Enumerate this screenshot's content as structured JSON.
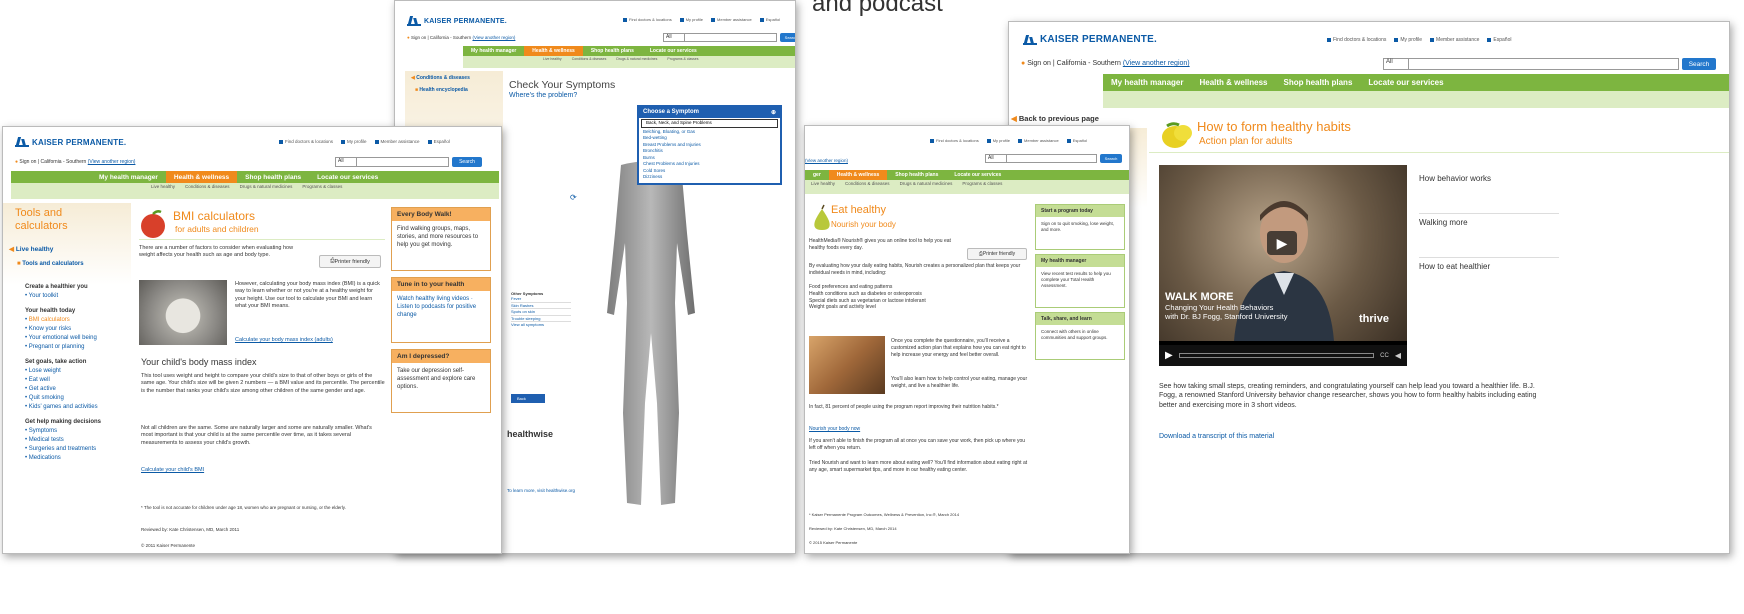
{
  "caption": {
    "text": "and podcast"
  },
  "common": {
    "brand": "KAISER PERMANENTE.",
    "utility_links": [
      "Find doctors & locations",
      "My profile",
      "Member assistance"
    ],
    "espanol": "Español",
    "sign_on": "Sign on",
    "region": "California - Southern",
    "view_region": "(View another region)",
    "search_select": "All",
    "search_btn": "Search",
    "nav": [
      "My health manager",
      "Health & wellness",
      "Shop health plans",
      "Locate our services"
    ],
    "subnav": [
      "Live healthy",
      "Conditions & diseases",
      "Drugs & natural medicines",
      "Programs & classes"
    ]
  },
  "page_bmi": {
    "side_title": "Tools and calculators",
    "side_back": "Live healthy",
    "side_current": "Tools and calculators",
    "side_groups": [
      {
        "h": "Create a healthier you",
        "items": [
          "Your toolkit"
        ]
      },
      {
        "h": "Your health today",
        "items": [
          "BMI calculators",
          "Know your risks",
          "Your emotional well being",
          "Pregnant or planning"
        ]
      },
      {
        "h": "Set goals, take action",
        "items": [
          "Lose weight",
          "Eat well",
          "Get active",
          "Quit smoking",
          "Kids' games and activities"
        ]
      },
      {
        "h": "Get help making decisions",
        "items": [
          "Symptoms",
          "Medical tests",
          "Surgeries and treatments",
          "Medications"
        ]
      }
    ],
    "title": "BMI calculators",
    "subtitle": "for adults and children",
    "intro": "There are a number of factors to consider when evaluating how weight affects your health such as age and body type.",
    "printer": "Printer friendly",
    "para1": "However, calculating your body mass index (BMI) is a quick way to learn whether or not you're at a healthy weight for your height. Use our tool to calculate your BMI and learn what your BMI means.",
    "link1": "Calculate your body mass index (adults)",
    "h2": "Your child's body mass index",
    "para2": "This tool uses weight and height to compare your child's size to that of other boys or girls of the same age. Your child's size will be given 2 numbers — a BMI value and its percentile. The percentile is the number that ranks your child's size among other children of the same gender and age.",
    "para3": "Not all children are the same. Some are naturally larger and some are naturally smaller. What's most important is that your child is at the same percentile over time, as it takes several measurements to assess your child's growth.",
    "link2": "Calculate your child's BMI",
    "foot1": "* The tool is not accurate for children under age 18, women who are pregnant or nursing, or the elderly.",
    "foot2": "Reviewed by: Kate Christensen, MD, March 2011",
    "foot3": "© 2011 Kaiser Permanente",
    "cards": [
      {
        "h": "Every Body Walk!",
        "b": "Find walking groups, maps, stories, and more resources to help you get moving."
      },
      {
        "h": "Tune in to your health",
        "b": "Watch healthy living videos · Listen to podcasts for positive change"
      },
      {
        "h": "Am I depressed?",
        "b": "Take our depression self-assessment and explore care options."
      }
    ]
  },
  "page_symptoms": {
    "side_links": [
      "Conditions & diseases",
      "Health encyclopedia"
    ],
    "title": "Check Your Symptoms",
    "subtitle": "Where's the problem?",
    "chooser_title": "Choose a Symptom",
    "chooser_items": [
      "Back, Neck, and Spine Problems",
      "Belching, Bloating, or Gas",
      "Bed-wetting",
      "Breast Problems and Injuries",
      "Bronchitis",
      "Burns",
      "Chest Problems and Injuries",
      "Cold Sores",
      "Dizziness",
      "Ear Problems and Injuries",
      "Fever"
    ],
    "other_head": "Other Symptoms",
    "other_items": [
      "Fever",
      "Skin Rashes",
      "Spots on skin",
      "Trouble sleeping",
      "View all symptoms"
    ],
    "back": "Back",
    "brand2": "healthwise",
    "learn": "To learn more, visit healthwise.org"
  },
  "page_eat": {
    "title": "Eat healthy",
    "subtitle": "Nourish your body",
    "intro": "HealthMedia® Nourish® gives you an online tool to help you eat healthy foods every day.",
    "printer": "Printer friendly",
    "para1": "By evaluating how your daily eating habits, Nourish creates a personalized plan that keeps your individual needs in mind, including:",
    "list": [
      "Food preferences and eating patterns",
      "Health conditions such as diabetes or osteoporosis",
      "Special diets such as vegetarian or lactose intolerant",
      "Weight goals and activity level"
    ],
    "para2": "Once you complete the questionnaire, you'll receive a customized action plan that explains how you can eat right to help increase your energy and feel better overall.",
    "para3": "You'll also learn how to help control your eating, manage your weight, and live a healthier life.",
    "para4": "In fact, 81 percent of people using the program report improving their nutrition habits.*",
    "link1": "Nourish your body now",
    "para5": "If you aren't able to finish the program all at once you can save your work, then pick up where you left off when you return.",
    "para6": "Tried Nourish and want to learn more about eating well? You'll find information about eating right at any age, smart supermarket tips, and more in our healthy eating center.",
    "foot1": "* Kaiser Permanente Program Outcomes, Wellness & Prevention, Inc.®, March 2014",
    "foot2": "Reviewed by: Kate Christensen, MD, March 2014",
    "foot3": "© 2015 Kaiser Permanente",
    "cards": [
      {
        "h": "Start a program today",
        "b": "Sign on to quit smoking, lose weight, and more."
      },
      {
        "h": "My health manager",
        "b": "View recent test results to help you complete your Total Health Assessment."
      },
      {
        "h": "Talk, share, and learn",
        "b": "Connect with others in online communities and support groups."
      }
    ]
  },
  "page_habits": {
    "back": "Back to previous page",
    "title": "How to form healthy habits",
    "subtitle": "Action plan for adults",
    "video_title": "WALK MORE",
    "video_sub1": "Changing Your Health Behaviors",
    "video_sub2": "with Dr. BJ Fogg, Stanford University",
    "video_brand": "thrive",
    "playlist": [
      "How behavior works",
      "Walking more",
      "How to eat healthier"
    ],
    "desc": "See how taking small steps, creating reminders, and congratulating yourself can help lead you toward a healthier life. B.J. Fogg, a renowned Stanford University behavior change researcher, shows you how to form healthy habits including eating better and exercising more in 3 short videos.",
    "download": "Download a transcript of this material"
  }
}
